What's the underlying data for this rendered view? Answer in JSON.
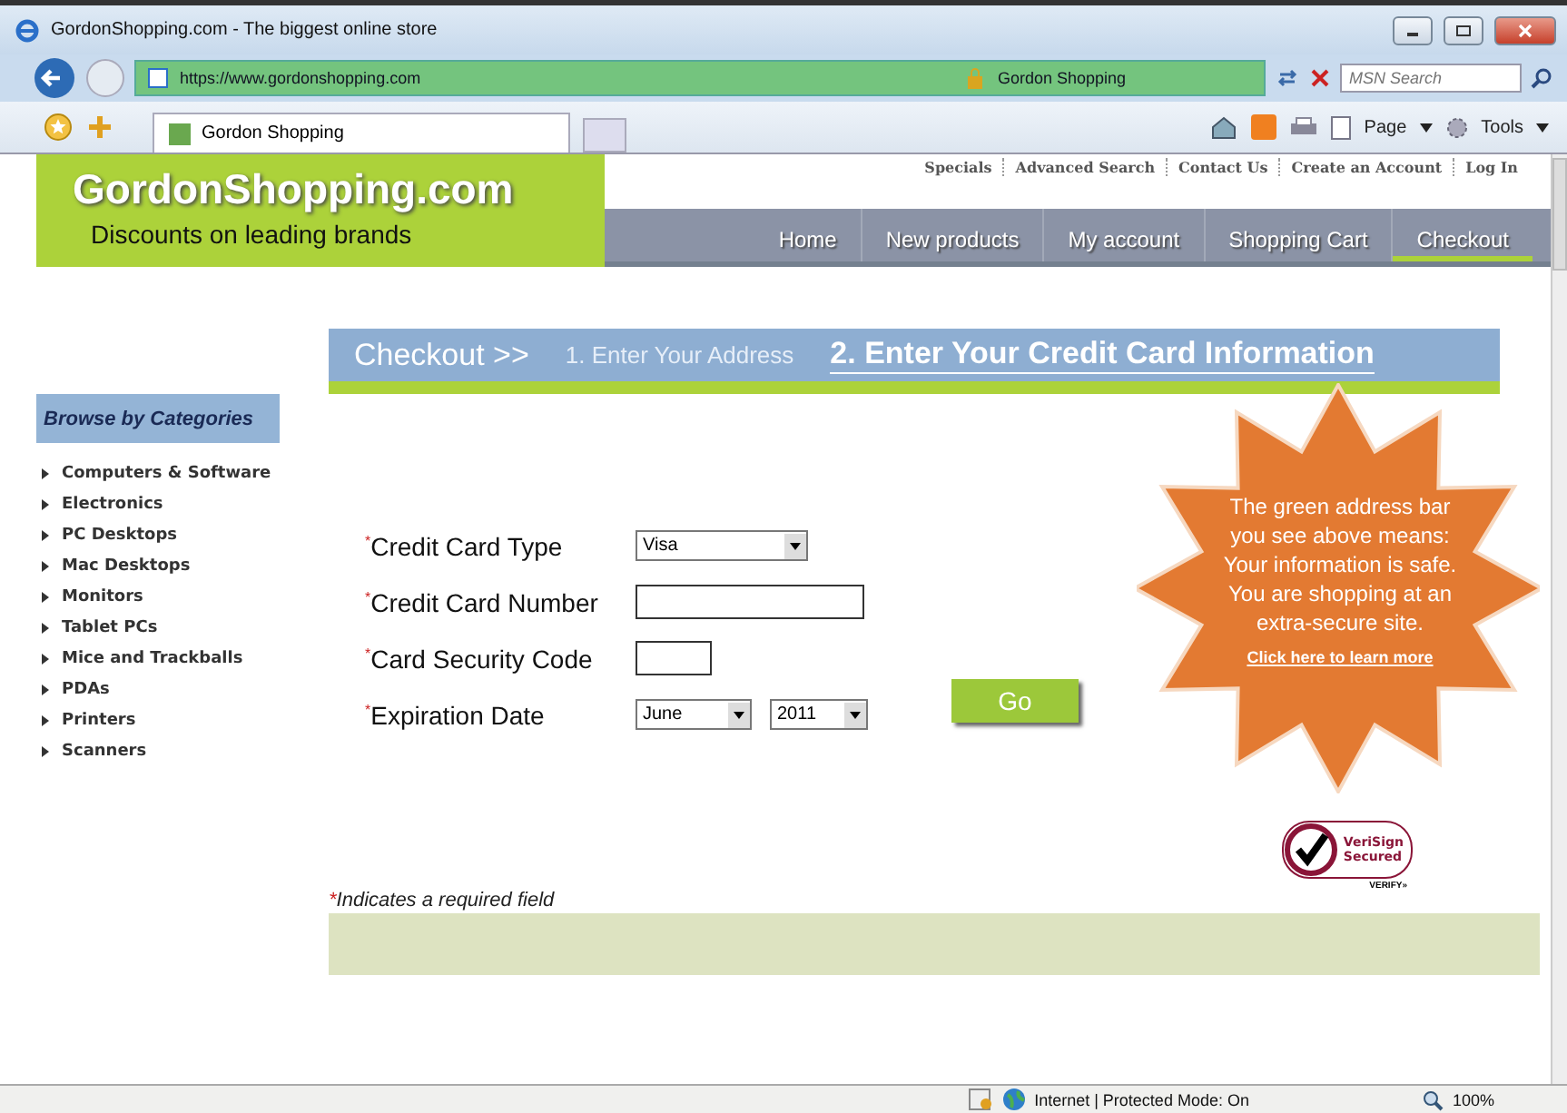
{
  "browser": {
    "title": "GordonShopping.com - The biggest online store",
    "url": "https://www.gordonshopping.com",
    "identity": "Gordon Shopping",
    "search_placeholder": "MSN Search",
    "tab": "Gordon Shopping",
    "tools": [
      "Page",
      "Tools"
    ]
  },
  "header": {
    "logo": "GordonShopping.com",
    "tagline": "Discounts on leading brands",
    "top_links": [
      "Specials",
      "Advanced Search",
      "Contact Us",
      "Create an Account",
      "Log In"
    ],
    "nav": [
      {
        "label": "Home",
        "selected": false
      },
      {
        "label": "New products",
        "selected": false
      },
      {
        "label": "My account",
        "selected": false
      },
      {
        "label": "Shopping Cart",
        "selected": false
      },
      {
        "label": "Checkout",
        "selected": true
      }
    ]
  },
  "checkout": {
    "title": "Checkout >>",
    "steps": [
      {
        "label": "1. Enter Your Address",
        "selected": false
      },
      {
        "label": "2. Enter Your Credit Card Information",
        "selected": true
      }
    ]
  },
  "sidebar": {
    "heading": "Browse by Categories",
    "items": [
      "Computers & Software",
      "Electronics",
      "PC Desktops",
      "Mac Desktops",
      "Monitors",
      "Tablet PCs",
      "Mice and Trackballs",
      "PDAs",
      "Printers",
      "Scanners"
    ]
  },
  "form": {
    "fields": [
      {
        "kind": "select",
        "mark": "*",
        "label": "Credit Card Type",
        "values": [
          "Visa"
        ]
      },
      {
        "kind": "text",
        "mark": "*",
        "label": "Credit Card Number"
      },
      {
        "kind": "short_text",
        "mark": "*",
        "label": "Card Security Code"
      },
      {
        "kind": "date",
        "mark": "*",
        "label": "Expiration Date",
        "values": [
          "June",
          "2011"
        ]
      }
    ],
    "submit": "Go",
    "note_mark": "*",
    "note": "Indicates a required field"
  },
  "promo": {
    "text": "The green address bar you see above means: Your information is safe. You are shopping at an extra-secure site.",
    "link": "Click here to learn more"
  },
  "seal": {
    "name": "VeriSign",
    "sub": "Secured",
    "verify": "VERIFY»"
  },
  "status": {
    "zone": "Internet | Protected Mode: On",
    "zoom": "100%"
  }
}
